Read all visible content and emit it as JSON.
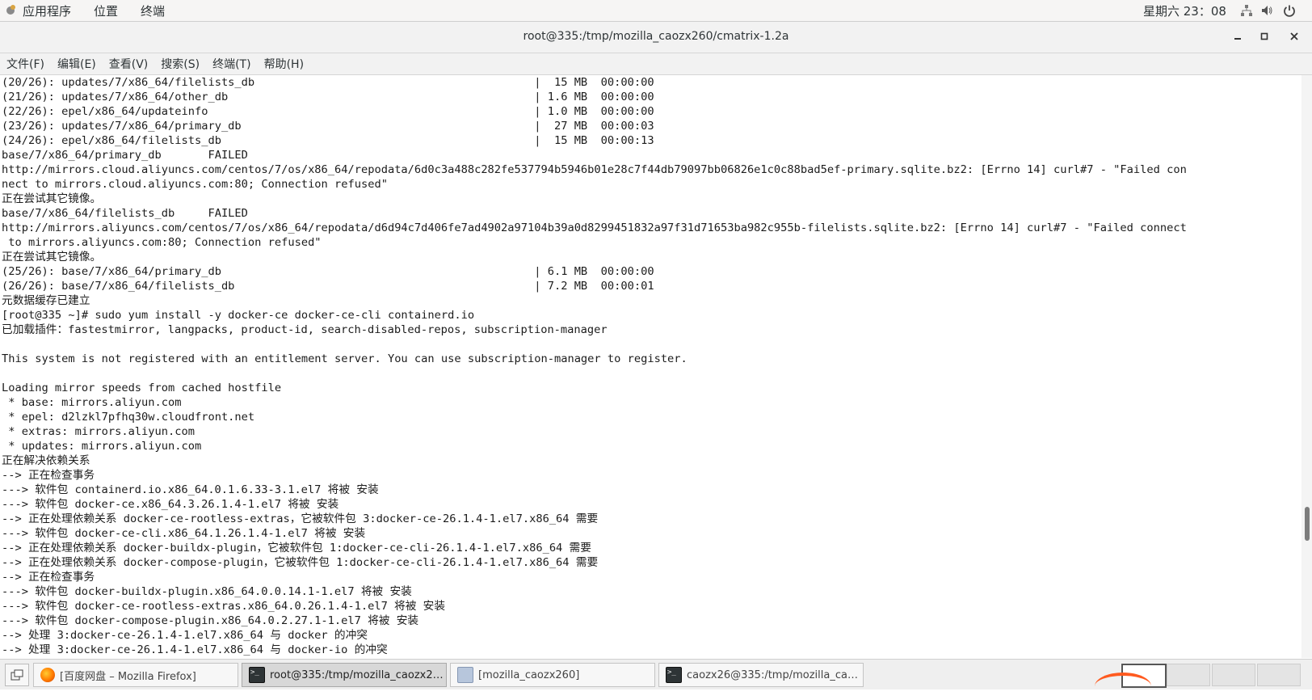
{
  "top_bar": {
    "menus": [
      "应用程序",
      "位置",
      "终端"
    ],
    "clock": "星期六 23：08",
    "tray_icons": [
      "network-icon",
      "volume-icon",
      "power-icon"
    ]
  },
  "window": {
    "title": "root@335:/tmp/mozilla_caozx260/cmatrix-1.2a",
    "buttons": [
      "minimize",
      "maximize",
      "close"
    ]
  },
  "menubar": {
    "items": [
      "文件(F)",
      "编辑(E)",
      "查看(V)",
      "搜索(S)",
      "终端(T)",
      "帮助(H)"
    ]
  },
  "terminal": {
    "lines": [
      "(20/26): updates/7/x86_64/filelists_db                                          |  15 MB  00:00:00",
      "(21/26): updates/7/x86_64/other_db                                              | 1.6 MB  00:00:00",
      "(22/26): epel/x86_64/updateinfo                                                 | 1.0 MB  00:00:00",
      "(23/26): updates/7/x86_64/primary_db                                            |  27 MB  00:00:03",
      "(24/26): epel/x86_64/filelists_db                                               |  15 MB  00:00:13",
      "base/7/x86_64/primary_db       FAILED",
      "http://mirrors.cloud.aliyuncs.com/centos/7/os/x86_64/repodata/6d0c3a488c282fe537794b5946b01e28c7f44db79097bb06826e1c0c88bad5ef-primary.sqlite.bz2: [Errno 14] curl#7 - \"Failed con",
      "nect to mirrors.cloud.aliyuncs.com:80; Connection refused\"",
      "正在尝试其它镜像。",
      "base/7/x86_64/filelists_db     FAILED",
      "http://mirrors.aliyuncs.com/centos/7/os/x86_64/repodata/d6d94c7d406fe7ad4902a97104b39a0d8299451832a97f31d71653ba982c955b-filelists.sqlite.bz2: [Errno 14] curl#7 - \"Failed connect",
      " to mirrors.aliyuncs.com:80; Connection refused\"",
      "正在尝试其它镜像。",
      "(25/26): base/7/x86_64/primary_db                                               | 6.1 MB  00:00:00",
      "(26/26): base/7/x86_64/filelists_db                                             | 7.2 MB  00:00:01",
      "元数据缓存已建立",
      "[root@335 ~]# sudo yum install -y docker-ce docker-ce-cli containerd.io",
      "已加载插件：fastestmirror, langpacks, product-id, search-disabled-repos, subscription-manager",
      "",
      "This system is not registered with an entitlement server. You can use subscription-manager to register.",
      "",
      "Loading mirror speeds from cached hostfile",
      " * base: mirrors.aliyun.com",
      " * epel: d2lzkl7pfhq30w.cloudfront.net",
      " * extras: mirrors.aliyun.com",
      " * updates: mirrors.aliyun.com",
      "正在解决依赖关系",
      "--> 正在检查事务",
      "---> 软件包 containerd.io.x86_64.0.1.6.33-3.1.el7 将被 安装",
      "---> 软件包 docker-ce.x86_64.3.26.1.4-1.el7 将被 安装",
      "--> 正在处理依赖关系 docker-ce-rootless-extras，它被软件包 3:docker-ce-26.1.4-1.el7.x86_64 需要",
      "---> 软件包 docker-ce-cli.x86_64.1.26.1.4-1.el7 将被 安装",
      "--> 正在处理依赖关系 docker-buildx-plugin，它被软件包 1:docker-ce-cli-26.1.4-1.el7.x86_64 需要",
      "--> 正在处理依赖关系 docker-compose-plugin，它被软件包 1:docker-ce-cli-26.1.4-1.el7.x86_64 需要",
      "--> 正在检查事务",
      "---> 软件包 docker-buildx-plugin.x86_64.0.0.14.1-1.el7 将被 安装",
      "---> 软件包 docker-ce-rootless-extras.x86_64.0.26.1.4-1.el7 将被 安装",
      "---> 软件包 docker-compose-plugin.x86_64.0.2.27.1-1.el7 将被 安装",
      "--> 处理 3:docker-ce-26.1.4-1.el7.x86_64 与 docker 的冲突",
      "--> 处理 3:docker-ce-26.1.4-1.el7.x86_64 与 docker-io 的冲突"
    ]
  },
  "taskbar": {
    "tasks": [
      {
        "label": "[百度网盘 – Mozilla Firefox]",
        "icon": "firefox-icon"
      },
      {
        "label": "root@335:/tmp/mozilla_caozx260/…",
        "icon": "terminal-icon"
      },
      {
        "label": "[mozilla_caozx260]",
        "icon": "folder-icon"
      },
      {
        "label": "caozx26@335:/tmp/mozilla_caozx…",
        "icon": "terminal-icon"
      }
    ]
  }
}
